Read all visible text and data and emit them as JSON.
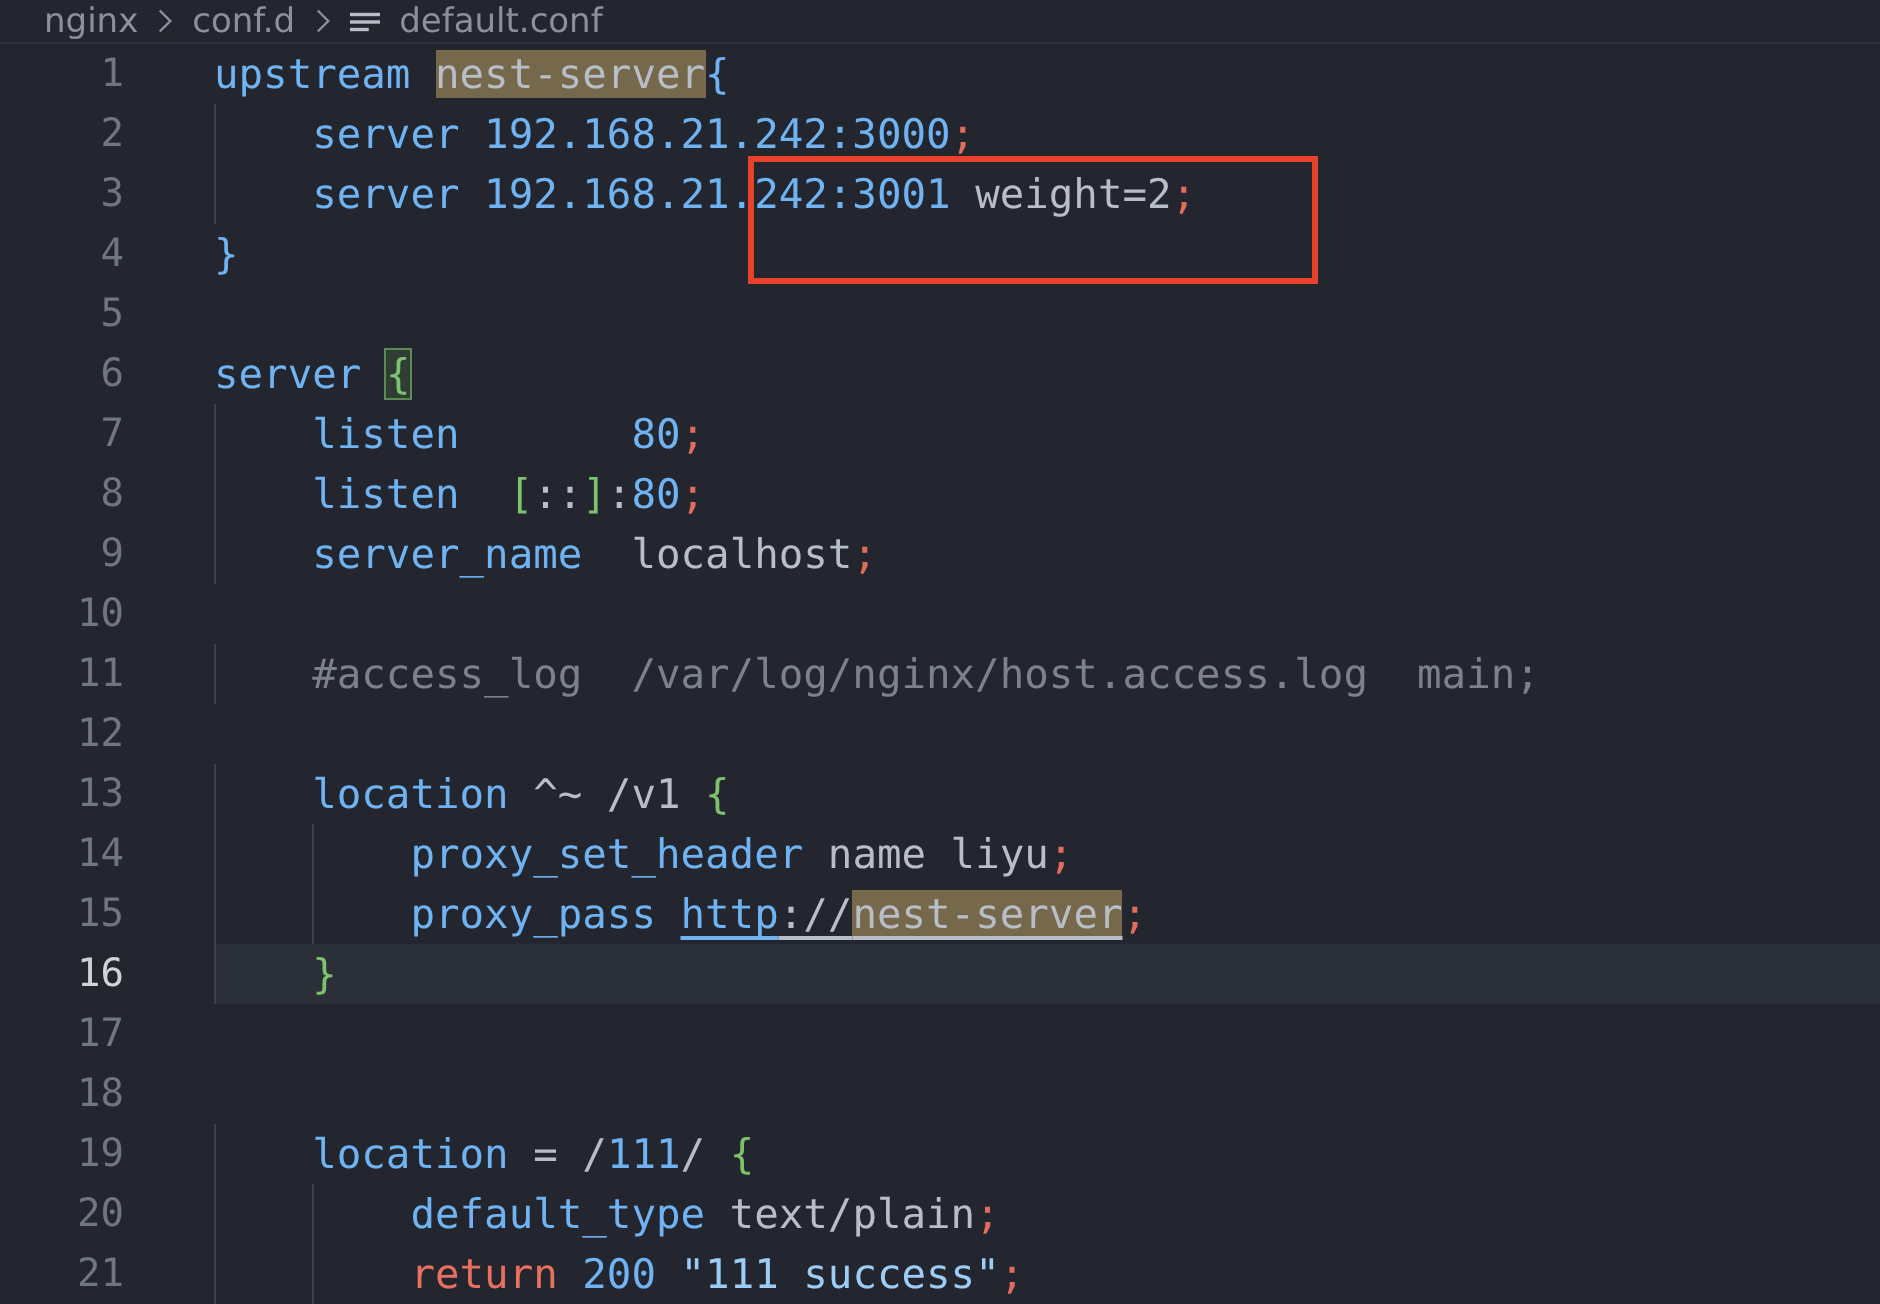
{
  "breadcrumb": [
    {
      "label": "nginx"
    },
    {
      "label": "conf.d"
    },
    {
      "label": "default.conf"
    }
  ],
  "lines": [
    {
      "number": "1",
      "current": false,
      "tokens": [
        {
          "text": "upstream ",
          "kind": "keyword"
        },
        {
          "text": "nest-server",
          "kind": "text",
          "highlight": true
        },
        {
          "text": "{",
          "kind": "keyword"
        }
      ]
    },
    {
      "number": "2",
      "current": false,
      "tokens": [
        {
          "text": "    server 192.168.21.242:3000",
          "kind": "keyword"
        },
        {
          "text": ";",
          "kind": "punct"
        }
      ]
    },
    {
      "number": "3",
      "current": false,
      "tokens": [
        {
          "text": "    server 192.168.21.242:3001",
          "kind": "keyword"
        },
        {
          "text": " weight=2",
          "kind": "text"
        },
        {
          "text": ";",
          "kind": "punct"
        }
      ]
    },
    {
      "number": "4",
      "current": false,
      "tokens": [
        {
          "text": "}",
          "kind": "keyword"
        }
      ]
    },
    {
      "number": "5",
      "current": false
    },
    {
      "number": "6",
      "current": false,
      "tokens": [
        {
          "text": "server ",
          "kind": "keyword"
        },
        {
          "text": "{",
          "kind": "bracket",
          "matched": true
        }
      ]
    },
    {
      "number": "7",
      "current": false,
      "tokens": [
        {
          "text": "    listen       ",
          "kind": "keyword"
        },
        {
          "text": "80",
          "kind": "keyword"
        },
        {
          "text": ";",
          "kind": "punct"
        }
      ]
    },
    {
      "number": "8",
      "current": false,
      "tokens": [
        {
          "text": "    listen  ",
          "kind": "keyword"
        },
        {
          "text": "[",
          "kind": "bracket"
        },
        {
          "text": "::",
          "kind": "text"
        },
        {
          "text": "]",
          "kind": "bracket"
        },
        {
          "text": ":",
          "kind": "text"
        },
        {
          "text": "80",
          "kind": "keyword"
        },
        {
          "text": ";",
          "kind": "punct"
        }
      ]
    },
    {
      "number": "9",
      "current": false,
      "tokens": [
        {
          "text": "    server_name",
          "kind": "keyword"
        },
        {
          "text": "  localhost",
          "kind": "text"
        },
        {
          "text": ";",
          "kind": "punct"
        }
      ]
    },
    {
      "number": "10",
      "current": false
    },
    {
      "number": "11",
      "current": false,
      "tokens": [
        {
          "text": "    #access_log  /var/log/nginx/host.access.log  main;",
          "kind": "comment"
        }
      ]
    },
    {
      "number": "12",
      "current": false
    },
    {
      "number": "13",
      "current": false,
      "tokens": [
        {
          "text": "    location",
          "kind": "keyword"
        },
        {
          "text": " ^~ /v1 ",
          "kind": "text"
        },
        {
          "text": "{",
          "kind": "bracket"
        }
      ]
    },
    {
      "number": "14",
      "current": false,
      "tokens": [
        {
          "text": "        proxy_set_header",
          "kind": "keyword"
        },
        {
          "text": " name liyu",
          "kind": "text"
        },
        {
          "text": ";",
          "kind": "punct"
        }
      ]
    },
    {
      "number": "15",
      "current": false,
      "tokens": [
        {
          "text": "        proxy_pass ",
          "kind": "keyword"
        },
        {
          "text": "http",
          "kind": "keyword",
          "underline": true
        },
        {
          "text": "://",
          "kind": "text",
          "underline": true
        },
        {
          "text": "nest-server",
          "kind": "text",
          "highlight": true,
          "underline": true
        },
        {
          "text": ";",
          "kind": "punct"
        }
      ]
    },
    {
      "number": "16",
      "current": true,
      "tokens": [
        {
          "text": "    }",
          "kind": "bracket"
        }
      ]
    },
    {
      "number": "17",
      "current": false
    },
    {
      "number": "18",
      "current": false
    },
    {
      "number": "19",
      "current": false,
      "tokens": [
        {
          "text": "    location",
          "kind": "keyword"
        },
        {
          "text": " = /",
          "kind": "text"
        },
        {
          "text": "111",
          "kind": "keyword"
        },
        {
          "text": "/ ",
          "kind": "text"
        },
        {
          "text": "{",
          "kind": "bracket"
        }
      ]
    },
    {
      "number": "20",
      "current": false,
      "tokens": [
        {
          "text": "        default_type",
          "kind": "keyword"
        },
        {
          "text": " text/plain",
          "kind": "text"
        },
        {
          "text": ";",
          "kind": "punct"
        }
      ]
    },
    {
      "number": "21",
      "current": false,
      "tokens": [
        {
          "text": "        return",
          "kind": "control"
        },
        {
          "text": " 200",
          "kind": "keyword"
        },
        {
          "text": " \"111 success\"",
          "kind": "string"
        },
        {
          "text": ";",
          "kind": "punct"
        }
      ]
    }
  ]
}
